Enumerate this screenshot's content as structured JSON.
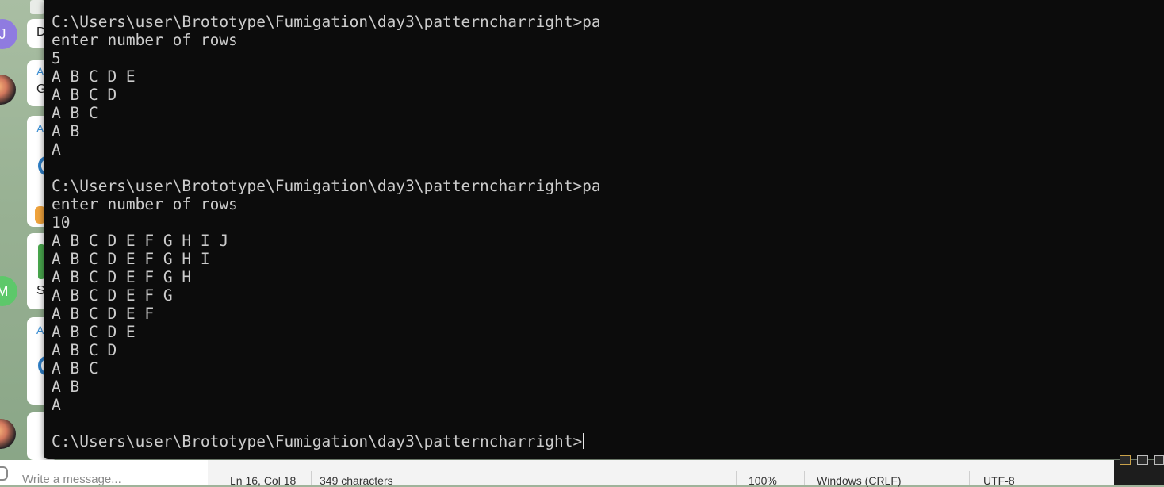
{
  "terminal": {
    "lines": [
      "C:\\Users\\user\\Brototype\\Fumigation\\day3\\patterncharright>pa",
      "enter number of rows",
      "5",
      "A B C D E",
      "A B C D",
      "A B C",
      "A B",
      "A",
      "",
      "C:\\Users\\user\\Brototype\\Fumigation\\day3\\patterncharright>pa",
      "enter number of rows",
      "10",
      "A B C D E F G H I J",
      "A B C D E F G H I",
      "A B C D E F G H",
      "A B C D E F G",
      "A B C D E F",
      "A B C D E",
      "A B C D",
      "A B C",
      "A B",
      "A",
      ""
    ],
    "prompt": "C:\\Users\\user\\Brototype\\Fumigation\\day3\\patterncharright>"
  },
  "chat": {
    "avatar_letters": [
      "J",
      "M"
    ],
    "bubble_letters": [
      "D",
      "G",
      "S"
    ],
    "bubble_accents": [
      "A",
      "A",
      "A"
    ],
    "input_placeholder": "Write a message..."
  },
  "statusbar": {
    "position": "Ln 16, Col 18",
    "characters": "349 characters",
    "zoom": "100%",
    "line_ending": "Windows (CRLF)",
    "encoding": "UTF-8"
  },
  "colors": {
    "terminal_bg": "#0c0c0c",
    "terminal_fg": "#cccccc",
    "statusbar_bg": "#f3f3f3"
  }
}
